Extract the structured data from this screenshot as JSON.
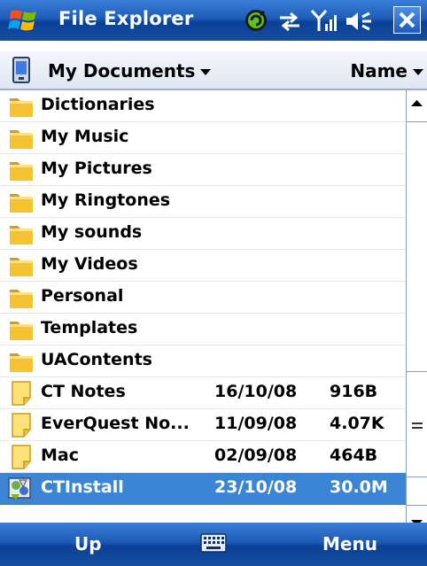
{
  "titlebar": {
    "title": "File Explorer",
    "icons": [
      "start-flag-icon",
      "connection-sync-icon",
      "data-transfer-icon",
      "signal-strength-icon",
      "volume-icon",
      "close-icon"
    ]
  },
  "header": {
    "folder_label": "My Documents",
    "sort_label": "Name",
    "folder_icon": "pda-device-icon"
  },
  "files": [
    {
      "name": "Dictionaries",
      "date": "",
      "size": "",
      "type": "folder"
    },
    {
      "name": "My Music",
      "date": "",
      "size": "",
      "type": "folder"
    },
    {
      "name": "My Pictures",
      "date": "",
      "size": "",
      "type": "folder"
    },
    {
      "name": "My Ringtones",
      "date": "",
      "size": "",
      "type": "folder"
    },
    {
      "name": "My sounds",
      "date": "",
      "size": "",
      "type": "folder"
    },
    {
      "name": "My Videos",
      "date": "",
      "size": "",
      "type": "folder"
    },
    {
      "name": "Personal",
      "date": "",
      "size": "",
      "type": "folder"
    },
    {
      "name": "Templates",
      "date": "",
      "size": "",
      "type": "folder"
    },
    {
      "name": "UAContents",
      "date": "",
      "size": "",
      "type": "folder"
    },
    {
      "name": "CT Notes",
      "date": "16/10/08",
      "size": "916B",
      "type": "note"
    },
    {
      "name": "EverQuest No...",
      "date": "11/09/08",
      "size": "4.07K",
      "type": "note"
    },
    {
      "name": "Mac",
      "date": "02/09/08",
      "size": "464B",
      "type": "note"
    },
    {
      "name": "CTInstall",
      "date": "23/10/08",
      "size": "30.0M",
      "type": "install",
      "selected": true
    }
  ],
  "softkeys": {
    "left": "Up",
    "right": "Menu",
    "center_icon": "keyboard-icon"
  },
  "colors": {
    "bar_blue": "#1e5cb8",
    "selection": "#3b85d4",
    "folder_yellow": "#f5c332",
    "note_yellow": "#fde27a"
  },
  "scroll": {
    "position": 0.9
  }
}
